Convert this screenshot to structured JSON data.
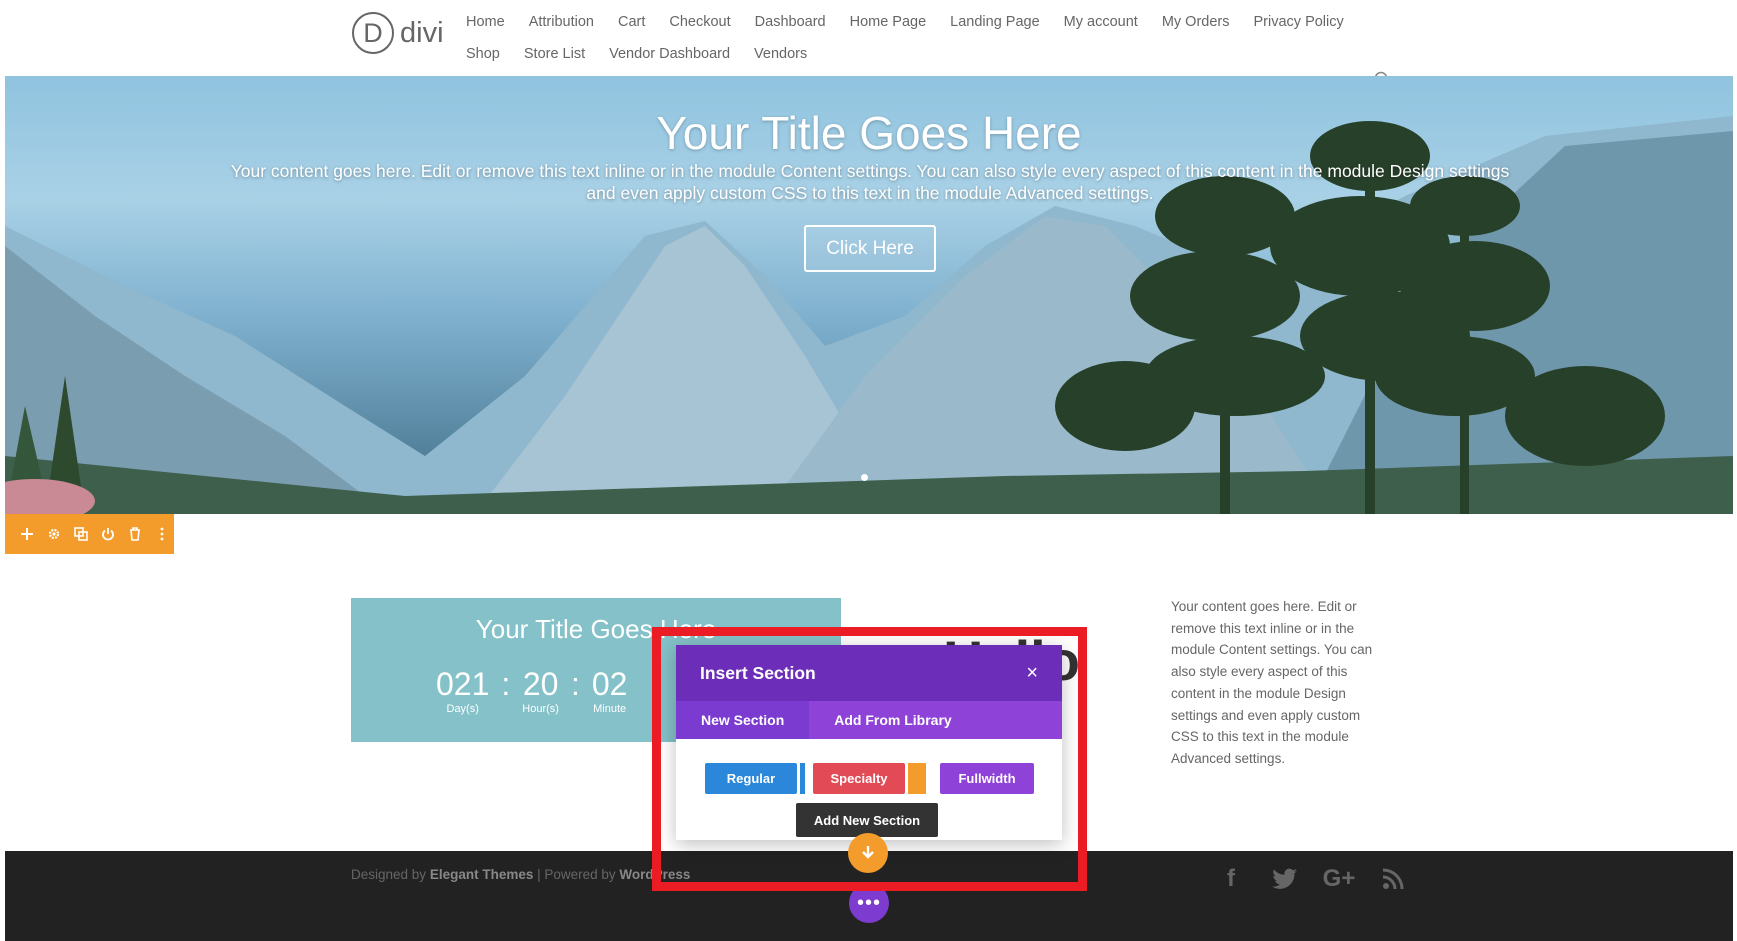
{
  "header": {
    "logo_letter": "D",
    "logo_text": "divi",
    "nav_row1": [
      "Home",
      "Attribution",
      "Cart",
      "Checkout",
      "Dashboard",
      "Home Page",
      "Landing Page",
      "My account",
      "My Orders",
      "Privacy Policy"
    ],
    "nav_row2": [
      "Shop",
      "Store List",
      "Vendor Dashboard",
      "Vendors"
    ]
  },
  "hero": {
    "title": "Your Title Goes Here",
    "text": "Your content goes here. Edit or remove this text inline or in the module Content settings. You can also style every aspect of this content in the module Design settings and even apply custom CSS to this text in the module Advanced settings.",
    "button_label": "Click Here"
  },
  "section_toolbar": {
    "icons": [
      "add-icon",
      "gear-icon",
      "duplicate-icon",
      "power-icon",
      "trash-icon",
      "more-icon"
    ]
  },
  "countdown": {
    "title": "Your Title Goes Here",
    "days": "021",
    "days_label": "Day(s)",
    "hours": "20",
    "hours_label": "Hour(s)",
    "minutes": "02",
    "minutes_label": "Minute",
    "separator": ":"
  },
  "hello_partial": "Hello",
  "side_text": "Your content goes here. Edit or remove this text inline or in the module Content settings. You can also style every aspect of this content in the module Design settings and even apply custom CSS to this text in the module Advanced settings.",
  "footer": {
    "designed_by": "Designed by ",
    "elegant": "Elegant Themes",
    "powered": " | Powered by ",
    "wordpress": "WordPress",
    "social": [
      "facebook-icon",
      "twitter-icon",
      "google-plus-icon",
      "rss-icon"
    ],
    "social_glyphs": [
      "f",
      "",
      "G+",
      ""
    ]
  },
  "modal": {
    "title": "Insert Section",
    "close": "×",
    "tab_new": "New Section",
    "tab_library": "Add From Library",
    "btn_regular": "Regular",
    "btn_specialty": "Specialty",
    "btn_fullwidth": "Fullwidth",
    "tooltip": "Add New Section"
  },
  "dots_button": "•••",
  "colors": {
    "purple_dark": "#6c2eb9",
    "purple": "#8e42d8",
    "orange": "#f39c2b",
    "highlight_red": "#ec1c24",
    "teal": "#84c1c8",
    "footer_bg": "#222222"
  }
}
